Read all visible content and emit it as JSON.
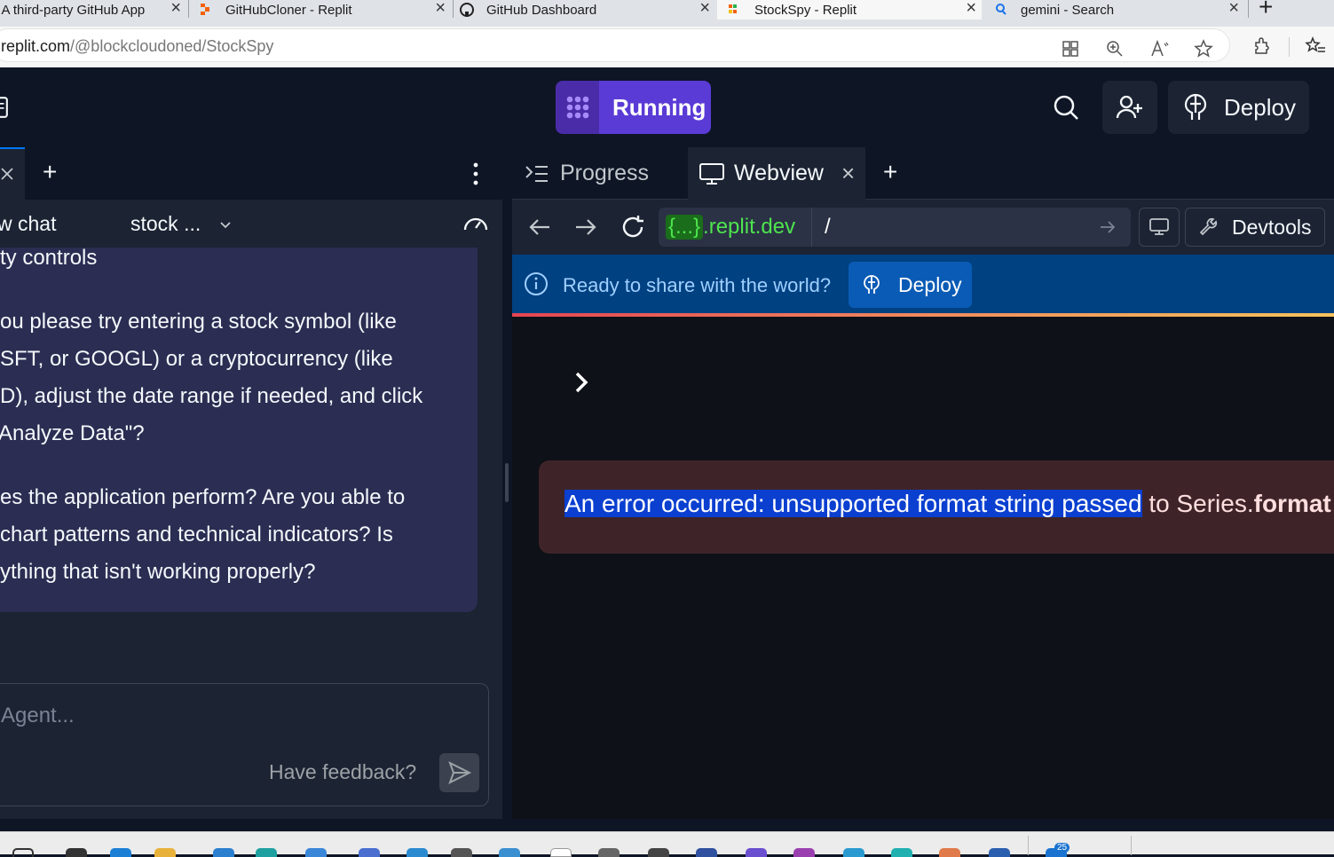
{
  "browser": {
    "tabs": [
      {
        "title": "[Private] A third-party GitHub App",
        "visible_title": "] A third-party GitHub App",
        "close": "×"
      },
      {
        "title": "GitHubCloner - Replit",
        "close": "×"
      },
      {
        "title": "GitHub Dashboard",
        "close": "×"
      },
      {
        "title": "StockSpy - Replit",
        "close": "×"
      },
      {
        "title": "gemini - Search",
        "close": "×"
      }
    ],
    "new_tab": "+",
    "url_host": "replit.com",
    "url_path": "/@blockcloudoned/StockSpy"
  },
  "header": {
    "run_label": "Running",
    "deploy_label": "Deploy",
    "colors": {
      "run_bg": "#5b3bd6",
      "run_icon_bg": "#4a2ca8"
    }
  },
  "left_panel": {
    "new_tab": "+",
    "chat_label": "w chat",
    "chat_title": "stock ...",
    "messages": [
      "ty controls",
      "ou please try entering a stock symbol (like",
      "SFT, or GOOGL) or a cryptocurrency (like",
      "D), adjust the date range if needed, and click",
      "“Analyze Data\"?",
      "es the application perform? Are you able to",
      "chart patterns and technical indicators? Is",
      "ything that isn't working properly?"
    ],
    "input_placeholder": "Agent...",
    "feedback_label": "Have feedback?"
  },
  "right_panel": {
    "tabs": [
      {
        "label": "Progress"
      },
      {
        "label": "Webview",
        "close": "×"
      }
    ],
    "new_tab": "+",
    "url_host_brace": "{...}",
    "url_host_domain": ".replit.dev",
    "url_path": "/",
    "devtools_label": "Devtools",
    "info_text": "Ready to share with the world?",
    "info_deploy": "Deploy",
    "error_selected": "An error occurred: unsupported format string passed",
    "error_rest": " to Series.",
    "error_bold": "format"
  },
  "taskbar": {
    "badge": "25"
  }
}
